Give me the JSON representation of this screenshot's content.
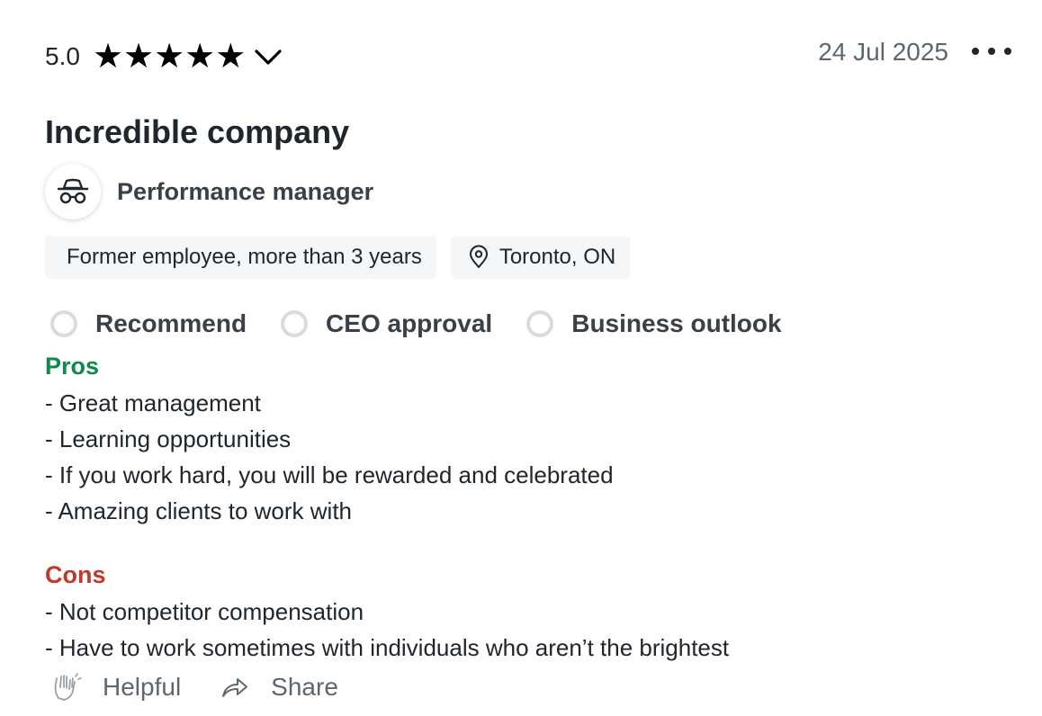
{
  "review": {
    "rating": "5.0",
    "star_count": 5,
    "date": "24 Jul 2025",
    "title": "Incredible company",
    "role": "Performance manager",
    "employment": "Former employee, more than 3 years",
    "location": "Toronto, ON"
  },
  "approvals": [
    {
      "label": "Recommend"
    },
    {
      "label": "CEO approval"
    },
    {
      "label": "Business outlook"
    }
  ],
  "pros": {
    "heading": "Pros",
    "lines": [
      "- Great management",
      "- Learning opportunities",
      "- If you work hard, you will be rewarded and celebrated",
      "- Amazing clients to work with"
    ]
  },
  "cons": {
    "heading": "Cons",
    "lines": [
      "- Not competitor compensation",
      "- Have to work sometimes with individuals who aren’t the brightest"
    ]
  },
  "actions": {
    "helpful_label": "Helpful",
    "share_label": "Share"
  },
  "icons": {
    "star": "star-icon",
    "chevron": "chevron-down-icon",
    "more": "more-horizontal-icon",
    "avatar": "incognito-icon",
    "location": "map-pin-icon",
    "helpful": "clapping-hands-icon",
    "share": "share-arrow-icon"
  },
  "colors": {
    "pros": "#0e8a4e",
    "cons": "#c0392b",
    "muted": "#5e6670"
  }
}
